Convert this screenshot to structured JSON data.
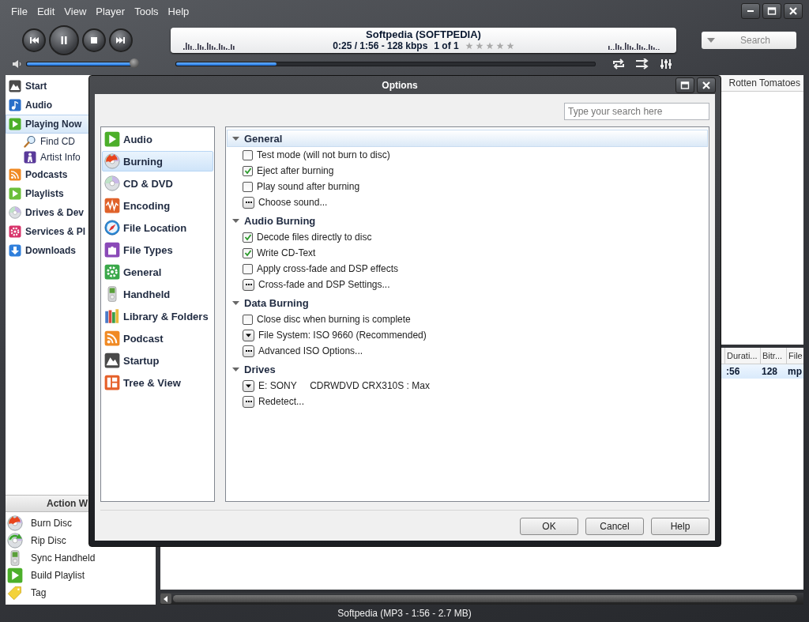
{
  "menu": [
    "File",
    "Edit",
    "View",
    "Player",
    "Tools",
    "Help"
  ],
  "now_playing": {
    "title": "Softpedia (SOFTPEDIA)",
    "time": "0:25 / 1:56 - 128 kbps",
    "position": "1 of 1",
    "stars": 0
  },
  "volume": {
    "level": 0.97
  },
  "progress": {
    "level": 0.24
  },
  "search": {
    "placeholder": "Search"
  },
  "sidebar": {
    "items": [
      {
        "label": "Start",
        "selected": false
      },
      {
        "label": "Audio",
        "selected": false
      },
      {
        "label": "Playing Now",
        "selected": true,
        "children": [
          {
            "label": "Find CD",
            "selected": false
          },
          {
            "label": "Artist Info",
            "selected": false
          }
        ]
      },
      {
        "label": "Podcasts",
        "selected": false
      },
      {
        "label": "Playlists",
        "selected": false
      },
      {
        "label": "Drives & Dev",
        "selected": false
      },
      {
        "label": "Services & Pl",
        "selected": false
      },
      {
        "label": "Downloads",
        "selected": false
      }
    ]
  },
  "action_window": {
    "title": "Action W",
    "items": [
      "Burn Disc",
      "Rip Disc",
      "Sync Handheld",
      "Build Playlist",
      "Tag"
    ]
  },
  "info_panel": {
    "tab": "Rotten Tomatoes"
  },
  "track_list": {
    "columns": [
      "Durati...",
      "Bitr...",
      "File"
    ],
    "rows": [
      {
        "cells": [
          ":56",
          "128",
          "mp"
        ],
        "selected": true
      }
    ]
  },
  "status_bar": "Softpedia (MP3 - 1:56 - 2.7 MB)",
  "dialog": {
    "title": "Options",
    "search_placeholder": "Type your search here",
    "categories": [
      {
        "label": "Audio",
        "selected": false
      },
      {
        "label": "Burning",
        "selected": true
      },
      {
        "label": "CD & DVD",
        "selected": false
      },
      {
        "label": "Encoding",
        "selected": false
      },
      {
        "label": "File Location",
        "selected": false
      },
      {
        "label": "File Types",
        "selected": false
      },
      {
        "label": "General",
        "selected": false
      },
      {
        "label": "Handheld",
        "selected": false
      },
      {
        "label": "Library & Folders",
        "selected": false
      },
      {
        "label": "Podcast",
        "selected": false
      },
      {
        "label": "Startup",
        "selected": false
      },
      {
        "label": "Tree & View",
        "selected": false
      }
    ],
    "groups": [
      {
        "title": "General",
        "selected": true,
        "expanded": true,
        "items": [
          {
            "kind": "checkbox",
            "label": "Test mode (will not burn to disc)",
            "checked": false
          },
          {
            "kind": "checkbox",
            "label": "Eject after burning",
            "checked": true
          },
          {
            "kind": "checkbox",
            "label": "Play sound after burning",
            "checked": false
          },
          {
            "kind": "button",
            "label": "Choose sound..."
          }
        ]
      },
      {
        "title": "Audio Burning",
        "selected": false,
        "expanded": true,
        "items": [
          {
            "kind": "checkbox",
            "label": "Decode files directly to disc",
            "checked": true
          },
          {
            "kind": "checkbox",
            "label": "Write CD-Text",
            "checked": true
          },
          {
            "kind": "checkbox",
            "label": "Apply cross-fade and DSP effects",
            "checked": false
          },
          {
            "kind": "button",
            "label": "Cross-fade and DSP Settings..."
          }
        ]
      },
      {
        "title": "Data Burning",
        "selected": false,
        "expanded": true,
        "items": [
          {
            "kind": "checkbox",
            "label": "Close disc when burning is complete",
            "checked": false
          },
          {
            "kind": "dropdown",
            "label": "File System: ISO 9660 (Recommended)"
          },
          {
            "kind": "button",
            "label": "Advanced ISO Options..."
          }
        ]
      },
      {
        "title": "Drives",
        "selected": false,
        "expanded": true,
        "items": [
          {
            "kind": "dropdown",
            "label": "E: SONY     CDRWDVD CRX310S : Max"
          },
          {
            "kind": "button",
            "label": "Redetect..."
          }
        ]
      }
    ],
    "buttons": [
      "OK",
      "Cancel",
      "Help"
    ]
  }
}
